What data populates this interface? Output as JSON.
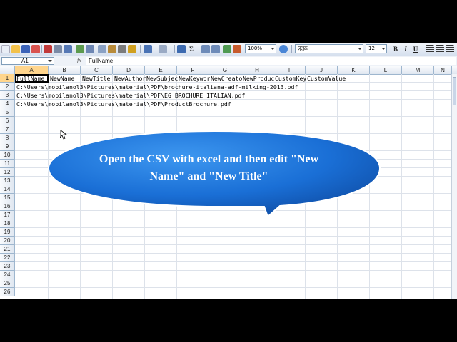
{
  "toolbar": {
    "zoom": "100%",
    "font_name": "宋体",
    "font_size": "12",
    "bold": "B",
    "italic": "I",
    "underline": "U",
    "sum_symbol": "Σ"
  },
  "formula_bar": {
    "name_box": "A1",
    "fx": "fx",
    "content": "FullName"
  },
  "columns": [
    "A",
    "B",
    "C",
    "D",
    "E",
    "F",
    "G",
    "H",
    "I",
    "J",
    "K",
    "L",
    "M",
    "N"
  ],
  "rows": [
    "1",
    "2",
    "3",
    "4",
    "5",
    "6",
    "7",
    "8",
    "9",
    "10",
    "11",
    "12",
    "13",
    "14",
    "15",
    "16",
    "17",
    "18",
    "19",
    "20",
    "21",
    "22",
    "23",
    "24",
    "25",
    "26"
  ],
  "cells": {
    "r1": [
      "FullName",
      "NewName",
      "NewTitle",
      "NewAuthor",
      "NewSubjec",
      "NewKeywor",
      "NewCreato",
      "NewProduc",
      "CustomKey",
      "CustomValue"
    ],
    "r2": "C:\\Users\\mobilanol3\\Pictures\\material\\PDF\\brochure-italiana-adf-milking-2013.pdf",
    "r3": "C:\\Users\\mobilanol3\\Pictures\\material\\PDF\\EG BROCHURE ITALIAN.pdf",
    "r4": "C:\\Users\\mobilanol3\\Pictures\\material\\PDF\\ProductBrochure.pdf"
  },
  "callout": {
    "line1": "Open the CSV  with excel and then edit \"New",
    "line2": "Name\" and \"New Title\"",
    "fill_color": "#1a73d9"
  }
}
